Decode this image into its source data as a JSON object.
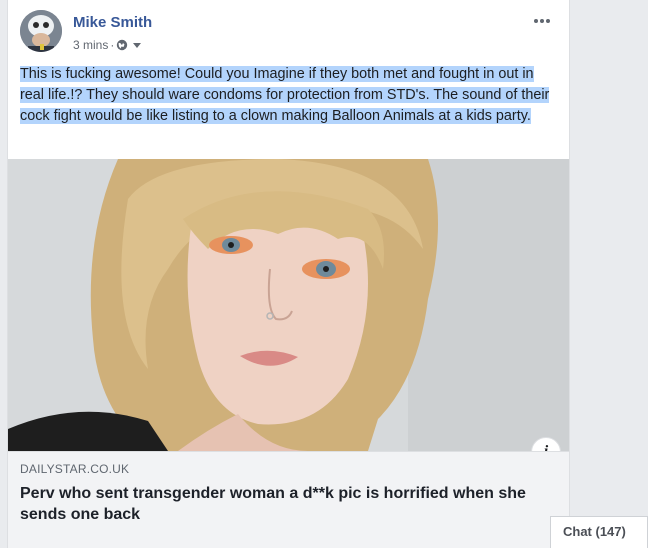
{
  "post": {
    "author": "Mike Smith",
    "timestamp": "3 mins",
    "separator": "·",
    "privacy_icon": "globe-icon",
    "menu_icon": "more-horizontal-icon",
    "text": "This is fucking awesome! Could you Imagine if they both met and fought in out in real life.!? They should ware condoms for protection from STD's. The sound of their cock fight would be like listing to a clown making Balloon Animals at a kids party."
  },
  "link": {
    "domain": "DAILYSTAR.CO.UK",
    "title": "Perv who sent transgender woman a d**k pic is horrified when she sends one back",
    "info_icon": "info-icon",
    "info_label": "i"
  },
  "chat": {
    "label": "Chat (147)"
  },
  "colors": {
    "author": "#385898",
    "highlight": "#b3d4fc",
    "background": "#e9ebee"
  }
}
